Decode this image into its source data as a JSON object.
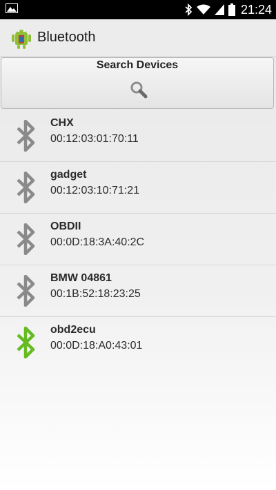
{
  "status_bar": {
    "time": "21:24",
    "icons": [
      "image-notification-icon",
      "bluetooth-icon",
      "wifi-icon",
      "signal-icon",
      "battery-icon"
    ]
  },
  "action_bar": {
    "title": "Bluetooth",
    "icon": "android-icon"
  },
  "search": {
    "label": "Search Devices",
    "icon": "search-icon"
  },
  "devices": [
    {
      "name": "CHX",
      "address": "00:12:03:01:70:11",
      "connected": false
    },
    {
      "name": "gadget",
      "address": "00:12:03:10:71:21",
      "connected": false
    },
    {
      "name": "OBDII",
      "address": "00:0D:18:3A:40:2C",
      "connected": false
    },
    {
      "name": "BMW 04861",
      "address": "00:1B:52:18:23:25",
      "connected": false
    },
    {
      "name": "obd2ecu",
      "address": "00:0D:18:A0:43:01",
      "connected": true
    }
  ],
  "colors": {
    "bt_inactive": "#8a8a8a",
    "bt_active": "#66bb22"
  }
}
